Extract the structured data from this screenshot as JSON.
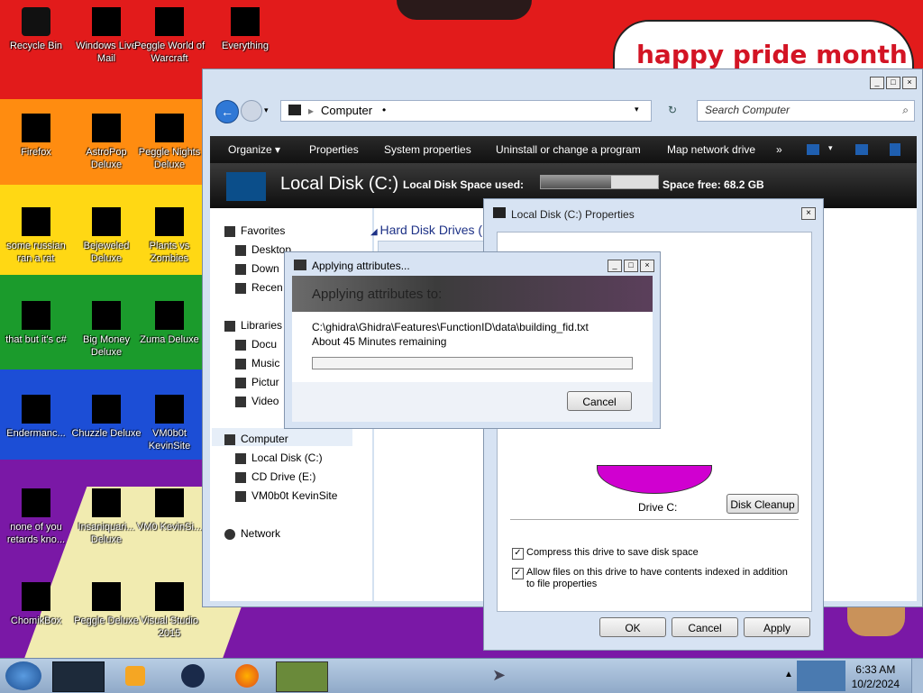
{
  "desktop": {
    "banner": "happy pride month",
    "icons": [
      {
        "label": "Recycle Bin"
      },
      {
        "label": "Windows Live Mail"
      },
      {
        "label": "Peggle World of Warcraft"
      },
      {
        "label": "Everything"
      },
      {
        "label": "Firefox"
      },
      {
        "label": "AstroPop Deluxe"
      },
      {
        "label": "Peggle Nights Deluxe"
      },
      {
        "label": "some russian ran a rat"
      },
      {
        "label": "Bejeweled Deluxe"
      },
      {
        "label": "Plants vs Zombies"
      },
      {
        "label": "that but it's c#"
      },
      {
        "label": "Big Money Deluxe"
      },
      {
        "label": "Zuma Deluxe"
      },
      {
        "label": "Endermanc..."
      },
      {
        "label": "Chuzzle Deluxe"
      },
      {
        "label": "VM0b0t KevinSite"
      },
      {
        "label": "none of you retards kno..."
      },
      {
        "label": "Insaniquari... Deluxe"
      },
      {
        "label": "VM0 KevinSi..."
      },
      {
        "label": "ChomikBox"
      },
      {
        "label": "Peggle Deluxe"
      },
      {
        "label": "Visual Studio 2015"
      }
    ]
  },
  "explorer": {
    "address": "Computer",
    "search_placeholder": "Search Computer",
    "toolbar": [
      "Organize ▾",
      "Properties",
      "System properties",
      "Uninstall or change a program",
      "Map network drive",
      "»"
    ],
    "header": {
      "title": "Local Disk (C:)",
      "space_used_label": "Local Disk  Space used:",
      "space_used_fraction": 0.6,
      "space_free": "Space free: 68.2 GB"
    },
    "nav": {
      "favorites": "Favorites",
      "desktop": "Desktop",
      "downloads": "Down",
      "recent": "Recen",
      "libraries": "Libraries",
      "documents": "Docu",
      "music": "Music",
      "pictures": "Pictur",
      "videos": "Video",
      "computer": "Computer",
      "local_disk": "Local Disk (C:)",
      "cd_drive": "CD Drive (E:)",
      "vm_site": "VM0b0t KevinSite",
      "network": "Network"
    },
    "content": {
      "group_title": "Hard Disk Drives (1"
    }
  },
  "properties": {
    "title": "Local Disk (C:) Properties",
    "drive_label": "Drive C:",
    "disk_cleanup": "Disk Cleanup",
    "compress_label": "Compress this drive to save disk space",
    "index_label": "Allow files on this drive to have contents indexed in addition to file properties",
    "ok": "OK",
    "cancel": "Cancel",
    "apply": "Apply"
  },
  "apply_dialog": {
    "title": "Applying attributes...",
    "heading": "Applying attributes to:",
    "path": "C:\\ghidra\\Ghidra\\Features\\FunctionID\\data\\building_fid.txt",
    "remaining": "About 45 Minutes remaining",
    "progress_fraction": 0.0,
    "cancel": "Cancel"
  },
  "taskbar": {
    "time": "6:33 AM",
    "date": "10/2/2024"
  },
  "colors": {
    "accent": "#2f78d6",
    "banner_text": "#d31424",
    "pie_used": "#d000d0"
  }
}
